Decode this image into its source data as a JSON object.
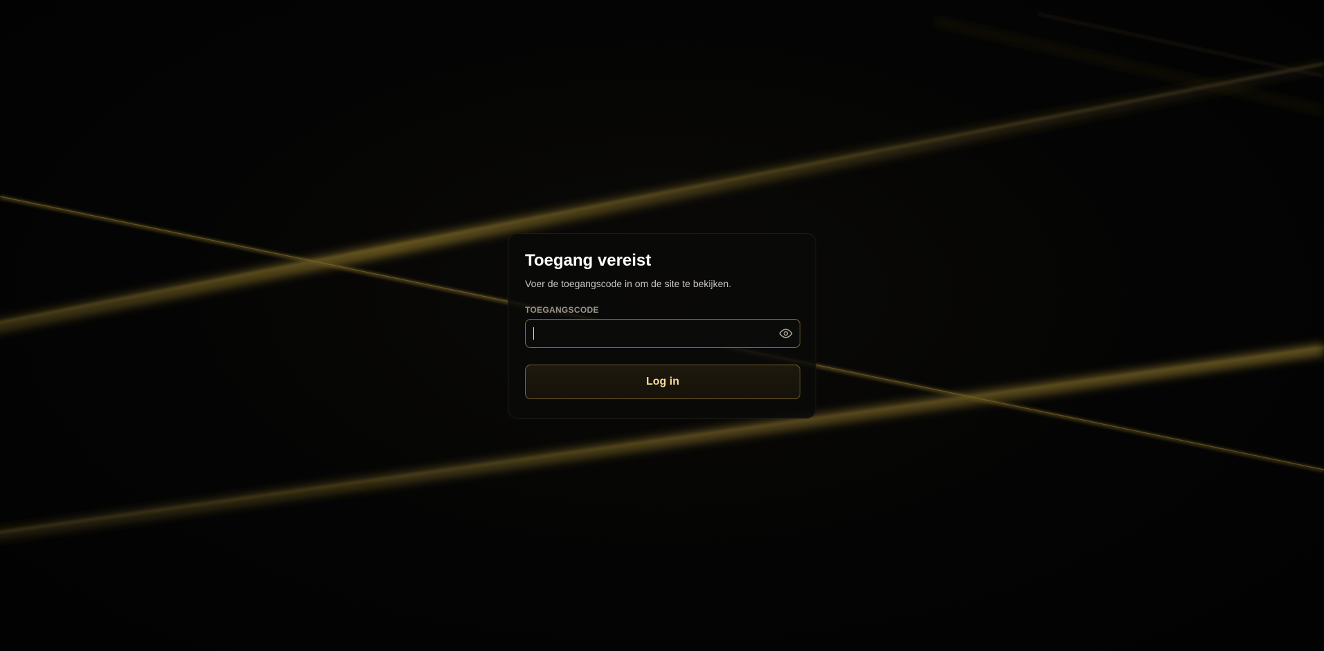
{
  "login": {
    "title": "Toegang vereist",
    "subtitle": "Voer de toegangscode in om de site te bekijken.",
    "code_label": "TOEGANGSCODE",
    "code_value": "",
    "code_placeholder": "",
    "submit_label": "Log in"
  },
  "icons": {
    "reveal": "eye-icon"
  },
  "colors": {
    "background": "#030303",
    "accent_gold": "#8a7030",
    "button_text": "#f3dea0",
    "title_text": "#ffffff"
  }
}
